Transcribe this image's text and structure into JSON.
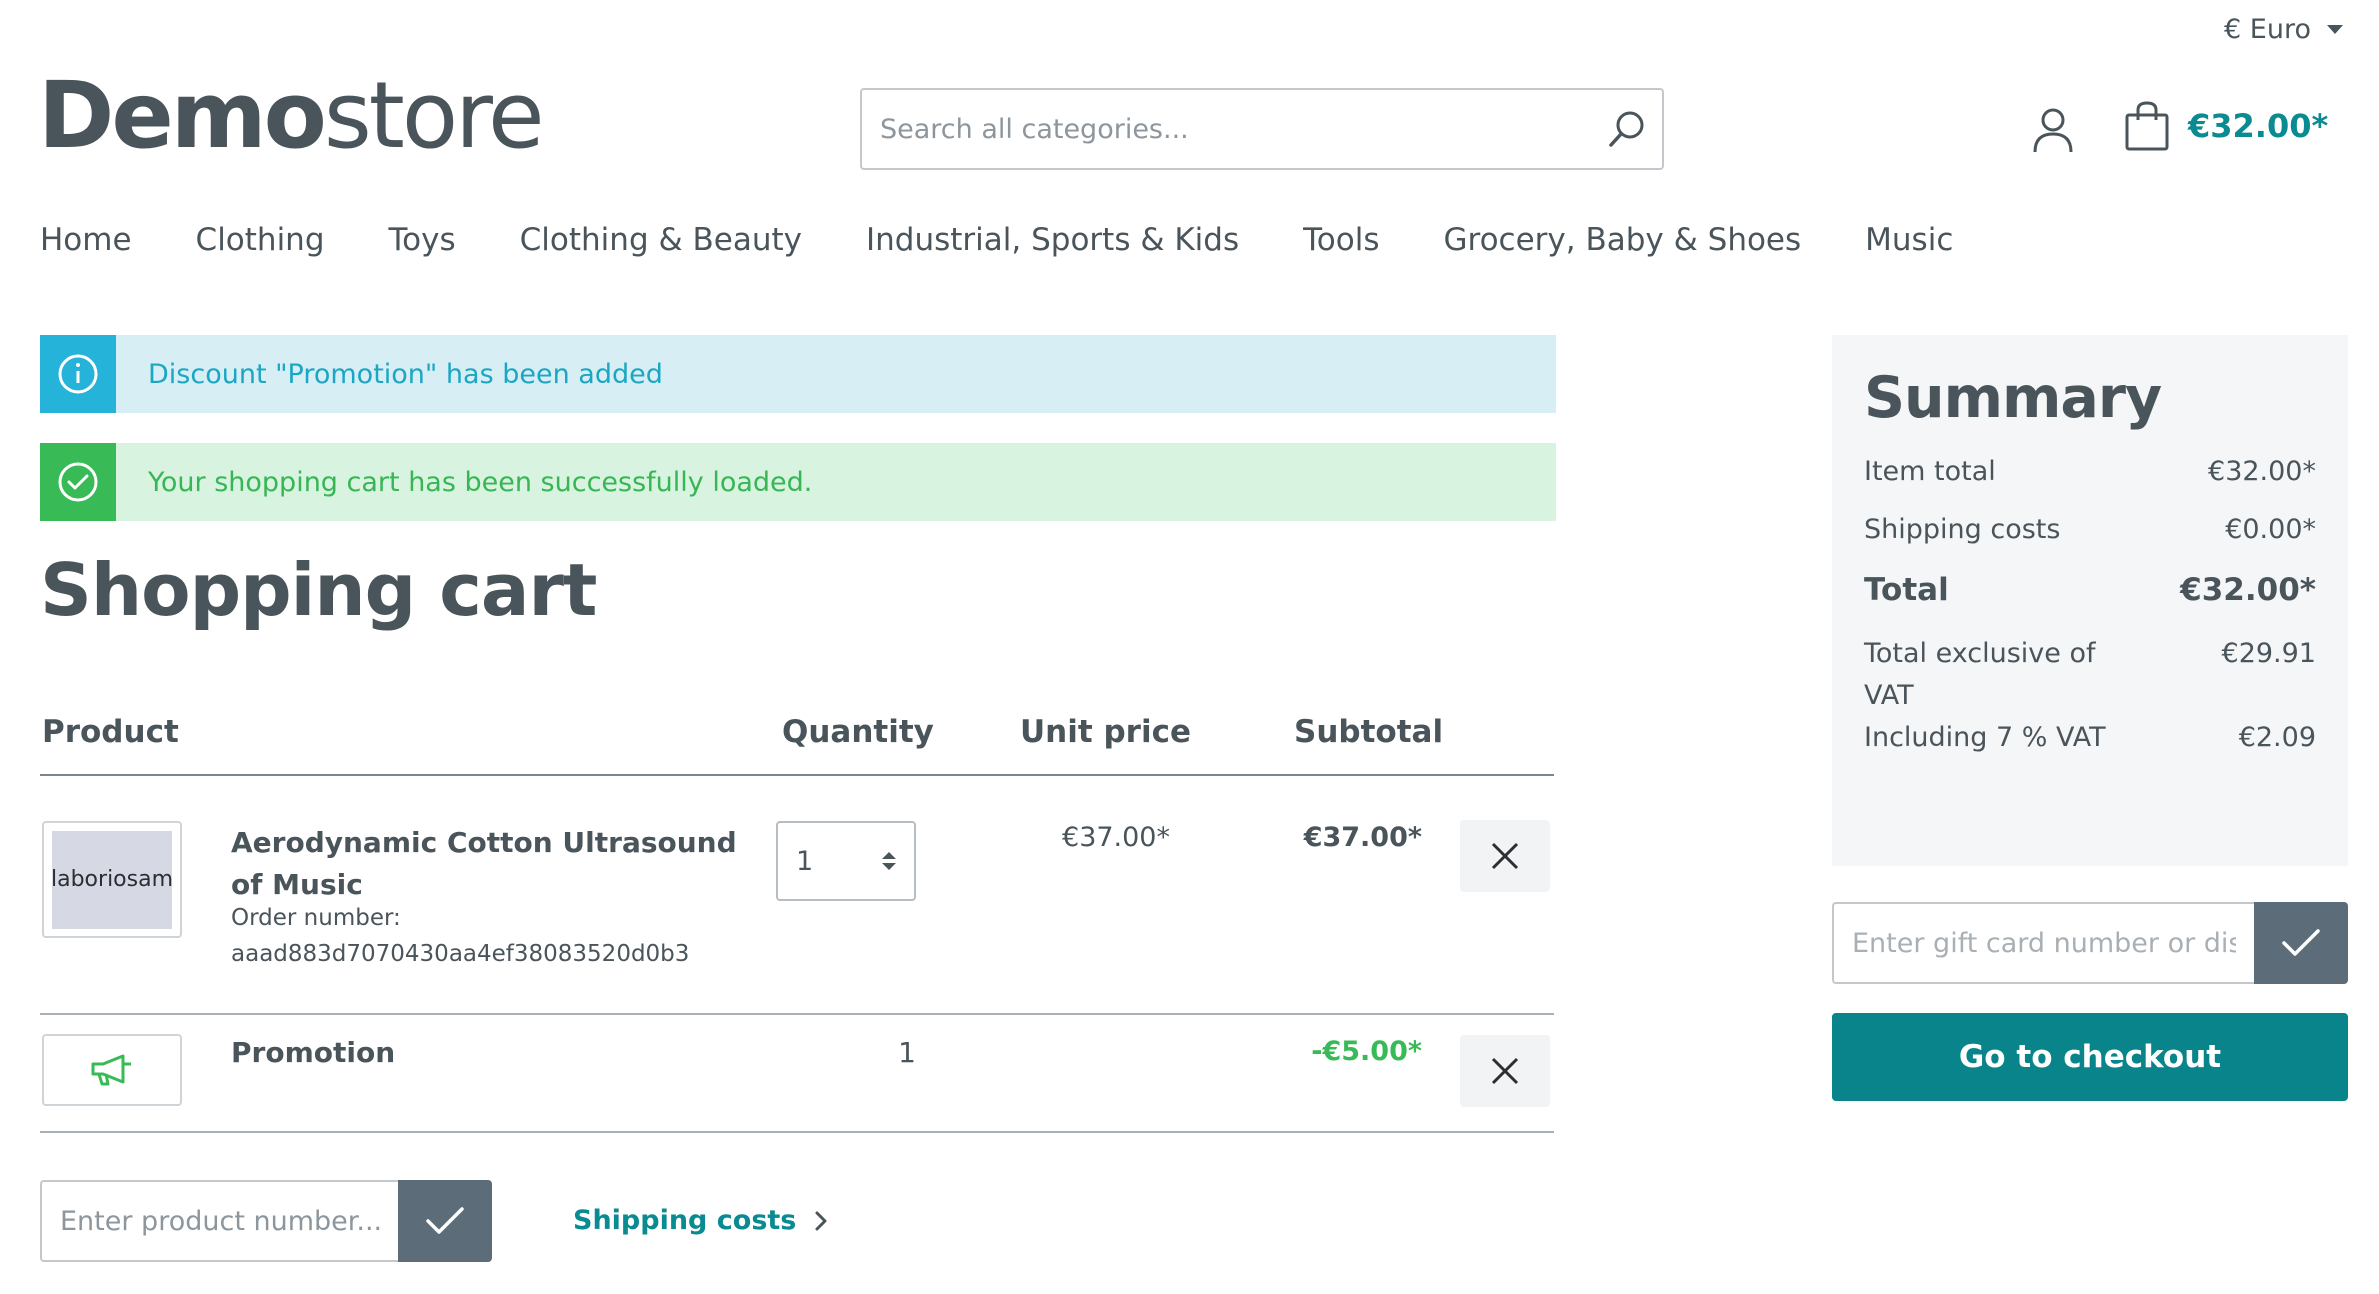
{
  "header": {
    "currency": "€ Euro",
    "logo_bold": "Demo",
    "logo_light": "store",
    "search_placeholder": "Search all categories...",
    "cart_total": "€32.00*"
  },
  "nav": [
    "Home",
    "Clothing",
    "Toys",
    "Clothing & Beauty",
    "Industrial, Sports & Kids",
    "Tools",
    "Grocery, Baby & Shoes",
    "Music"
  ],
  "alerts": {
    "info": "Discount \"Promotion\" has been added",
    "success": "Your shopping cart has been successfully loaded."
  },
  "page_title": "Shopping cart",
  "table": {
    "headers": {
      "product": "Product",
      "quantity": "Quantity",
      "unit_price": "Unit price",
      "subtotal": "Subtotal"
    },
    "items": [
      {
        "image_text": "laboriosam",
        "name": "Aerodynamic Cotton Ultrasound of Music",
        "order_label": "Order number:",
        "order_number": "aaad883d7070430aa4ef38083520d0b3",
        "quantity": "1",
        "unit_price": "€37.00*",
        "subtotal": "€37.00*"
      }
    ],
    "promotion": {
      "name": "Promotion",
      "quantity": "1",
      "subtotal": "-€5.00*"
    }
  },
  "product_number": {
    "placeholder": "Enter product number..."
  },
  "shipping_link": "Shipping costs",
  "summary": {
    "title": "Summary",
    "rows": [
      {
        "label": "Item total",
        "value": "€32.00*"
      },
      {
        "label": "Shipping costs",
        "value": "€0.00*"
      },
      {
        "label": "Total",
        "value": "€32.00*"
      },
      {
        "label": "Total exclusive of VAT",
        "value": "€29.91"
      },
      {
        "label": "Including 7 % VAT",
        "value": "€2.09"
      }
    ]
  },
  "giftcard": {
    "placeholder": "Enter gift card number or discount code..."
  },
  "checkout_label": "Go to checkout",
  "colors": {
    "accent": "#0a848b",
    "info": "#26b3d9",
    "success": "#38bb56",
    "text": "#4a545b"
  }
}
